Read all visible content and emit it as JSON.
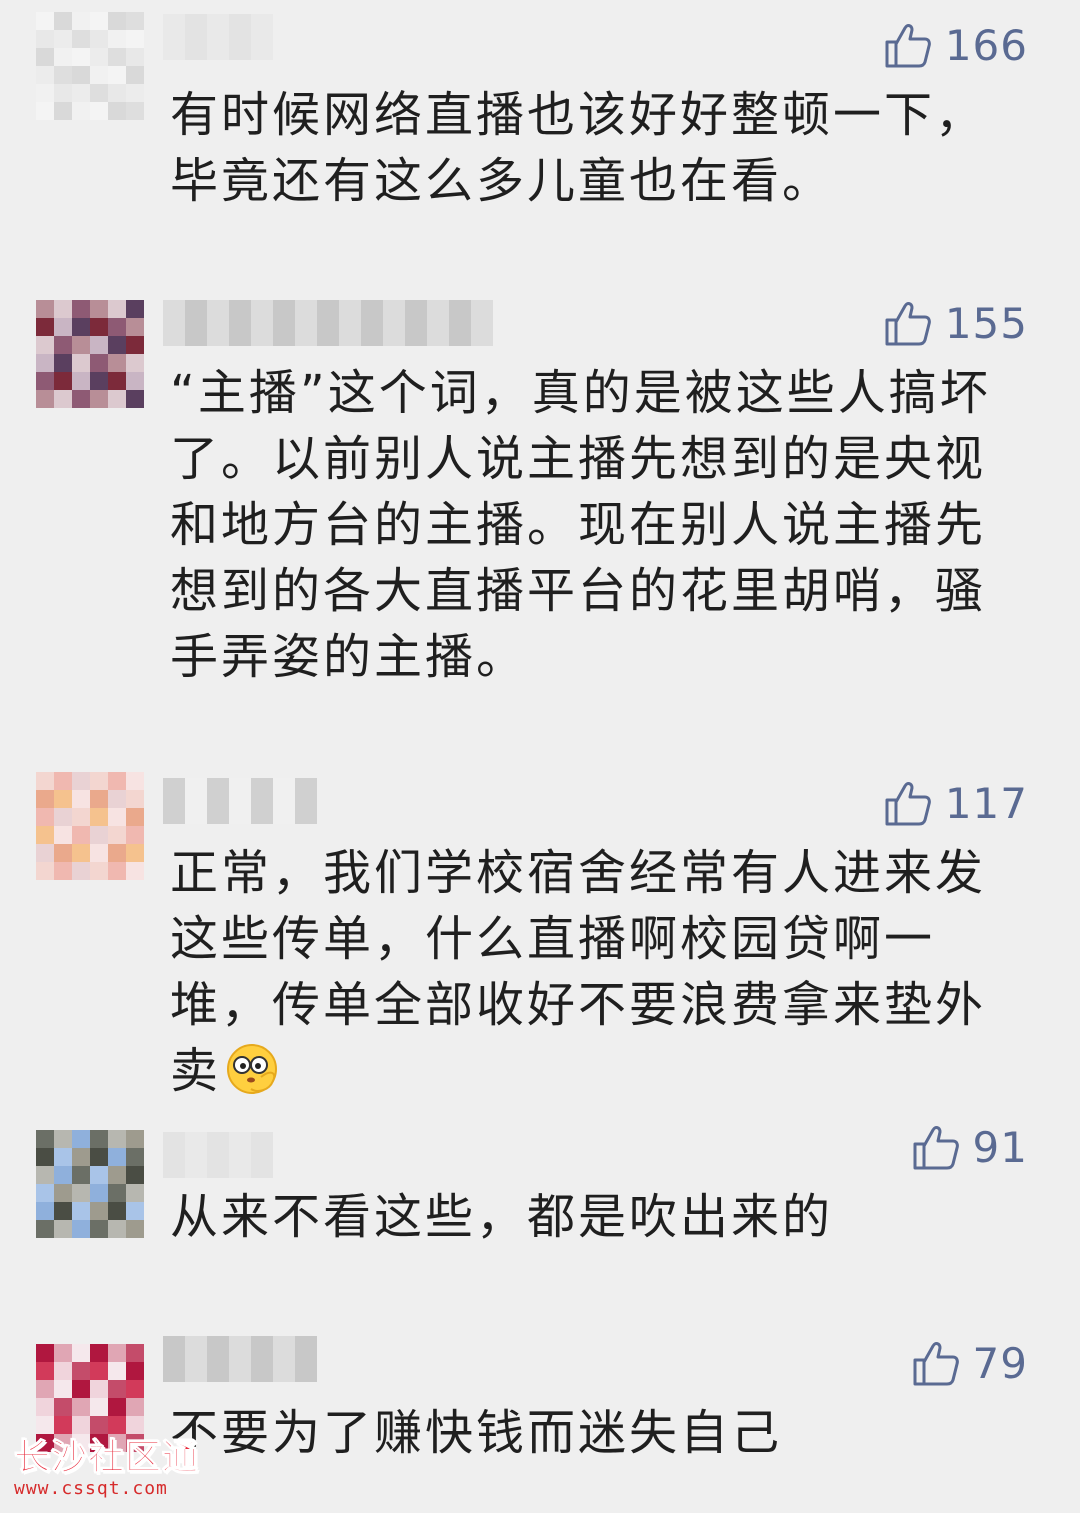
{
  "comments": [
    {
      "likes": "166",
      "text": "有时候网络直播也该好好整顿一下，毕竟还有这么多儿童也在看。",
      "avatar_colors": [
        "#f4f4f4",
        "#e8e8e8",
        "#d9d9d9",
        "#ececec",
        "#f1f1f1",
        "#dedede"
      ]
    },
    {
      "likes": "155",
      "text": "“主播”这个词，真的是被这些人搞坏了。以前别人说主播先想到的是央视和地方台的主播。现在别人说主播先想到的各大直播平台的花里胡哨，骚手弄姿的主播。",
      "avatar_colors": [
        "#c9b5c4",
        "#8e5a74",
        "#5a3f5f",
        "#b88e97",
        "#7c2a3a",
        "#dcc9cf"
      ]
    },
    {
      "likes": "117",
      "text": "正常，我们学校宿舍经常有人进来发这些传单，什么直播啊校园贷啊一堆，传单全部收好不要浪费拿来垫外卖",
      "avatar_colors": [
        "#f3d6d0",
        "#eaa98c",
        "#f0b8b0",
        "#f5c28e",
        "#e9d2d4",
        "#f7e3e2"
      ]
    },
    {
      "likes": "91",
      "text": "从来不看这些，都是吹出来的",
      "avatar_colors": [
        "#a9c4e8",
        "#8fb0dc",
        "#9e9b8e",
        "#6b6f66",
        "#4a4d44",
        "#b7b7b0"
      ]
    },
    {
      "likes": "79",
      "text": "不要为了赚快钱而迷失自己",
      "avatar_colors": [
        "#b0173f",
        "#d23a5a",
        "#e0a6b4",
        "#f0d4dc",
        "#f5e8ec",
        "#c44c6a"
      ]
    }
  ],
  "watermark": {
    "name": "长沙社区通",
    "url": "www.cssqt.com"
  },
  "icons": {
    "like": "thumbs-up-icon",
    "emoji": "thinking-face-emoji-icon"
  }
}
